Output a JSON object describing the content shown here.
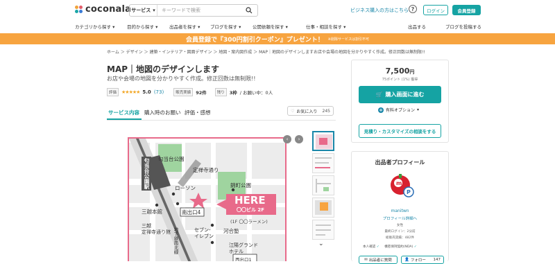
{
  "header": {
    "logo_text": "coconala",
    "search_category": "サービス",
    "search_placeholder": "キーワードで検索",
    "biz_link": "ビジネス購入の方はこちら",
    "login": "ログイン",
    "register": "会員登録"
  },
  "nav": {
    "items": [
      "カテゴリから探す",
      "目的から探す",
      "出品者を探す",
      "ブログを探す",
      "公開依頼を探す",
      "仕事・相談を探す",
      "出品する",
      "ブログを投稿する"
    ]
  },
  "banner": {
    "text": "会員登録で『300円割引クーポン』プレゼント！",
    "note": "※削除サービスは割引不可"
  },
  "breadcrumb": "ホーム ＞ デザイン ＞ 建築・インテリア・図面デザイン ＞ 地図・案内図作成 ＞ MAP｜地図のデザインしますお店や会場の地図を分かりやすく作成。修正回数は無制限!!",
  "service": {
    "title": "MAP｜地図のデザインします",
    "subtitle": "お店や会場の地図を分かりやすく作成。修正回数は無制限!!",
    "rating_label": "評価",
    "stars": "★★★★★",
    "score": "5.0",
    "reviews": "(73)",
    "sales_label": "販売実績",
    "sales": "92件",
    "remaining_label": "残り",
    "remaining": "3枠",
    "inquiry": "/ お願い中：0人"
  },
  "tabs": [
    "サービス内容",
    "購入時のお願い",
    "評価・感想"
  ],
  "favorite": {
    "label": "お気に入り",
    "count": "245"
  },
  "map": {
    "station": "匂当台公園駅",
    "park1": "勾当台公園",
    "street1": "定禅寺通り",
    "park2": "錦町公園",
    "lawson": "ローソン",
    "exit": "南出口4",
    "mitsukoshi": "三越本館",
    "here": "HERE",
    "building": "〇〇ビル 2F",
    "ramen": "(1F 〇〇ラーメン)",
    "mitsukoshi2": "三越\n定禅寺通り館",
    "road": "地下鉄南北線",
    "seven": "セブン-\nイレブン",
    "kawai": "河合塾",
    "hotel": "江陽グランド\nホテル",
    "westexit": "西出口1"
  },
  "purchase": {
    "price": "7,500",
    "yen": "円",
    "points": "75ポイント (1%) 獲得",
    "buy_button": "購入画面に進む",
    "option": "有料オプション",
    "consult": "見積り・カスタマイズの相談をする"
  },
  "profile": {
    "title": "出品者プロフィール",
    "username": "manitwn",
    "profile_link": "プロフィール詳細へ",
    "gender": "女性",
    "last_login": "最終ログイン：2分前",
    "total_sales": "総販売実績：482件",
    "identity": "本人確認",
    "nda": "機密保持契約(NDA)",
    "message_button": "出品者に質問",
    "follow_button": "フォロー",
    "follow_count": "147"
  },
  "colors": {
    "accent": "#15a3a3",
    "banner": "#f7a440",
    "map_frame": "#e86a8a",
    "link": "#1a87a9"
  }
}
